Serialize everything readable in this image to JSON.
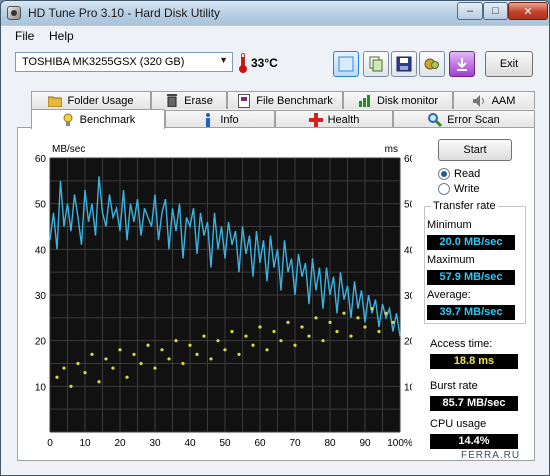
{
  "window": {
    "title": "HD Tune Pro 3.10 - Hard Disk Utility",
    "controls": {
      "minimize": "–",
      "maximize": "□",
      "close": "✕"
    }
  },
  "menu": {
    "file": "File",
    "help": "Help"
  },
  "toolbar": {
    "drive": "TOSHIBA MK3255GSX (320 GB)",
    "temperature": "33°C",
    "exit_label": "Exit",
    "icons": [
      "screenshot-icon",
      "copy-icon",
      "save-icon",
      "options-icon",
      "download-icon"
    ]
  },
  "tabs_top": [
    {
      "label": "Folder Usage",
      "icon": "folder-icon"
    },
    {
      "label": "Erase",
      "icon": "trash-icon"
    },
    {
      "label": "File Benchmark",
      "icon": "file-benchmark-icon"
    },
    {
      "label": "Disk monitor",
      "icon": "disk-monitor-icon"
    },
    {
      "label": "AAM",
      "icon": "speaker-icon"
    }
  ],
  "tabs_bottom": [
    {
      "label": "Benchmark",
      "icon": "benchmark-icon",
      "selected": true
    },
    {
      "label": "Info",
      "icon": "info-icon"
    },
    {
      "label": "Health",
      "icon": "health-icon"
    },
    {
      "label": "Error Scan",
      "icon": "magnifier-icon"
    }
  ],
  "controls": {
    "start_label": "Start",
    "read_label": "Read",
    "write_label": "Write",
    "mode": "Read"
  },
  "stats": {
    "transfer_rate_title": "Transfer rate",
    "minimum_label": "Minimum",
    "minimum_value": "20.0 MB/sec",
    "maximum_label": "Maximum",
    "maximum_value": "57.9 MB/sec",
    "average_label": "Average:",
    "average_value": "39.7 MB/sec",
    "access_label": "Access time:",
    "access_value": "18.8 ms",
    "burst_label": "Burst rate",
    "burst_value": "85.7 MB/sec",
    "cpu_label": "CPU usage",
    "cpu_value": "14.4%"
  },
  "watermark": "FERRA.RU",
  "colors": {
    "chart_bg": "#111111",
    "grid": "#3a3a3a",
    "transfer_line": "#3ab3e0",
    "access_dots": "#d8d848",
    "value_cyan": "#2ec8f0",
    "value_yellow": "#f2e73a"
  },
  "chart_data": {
    "type": "line",
    "ylabel_left": "MB/sec",
    "ylabel_right": "ms",
    "xlim": [
      0,
      100
    ],
    "ylim": [
      0,
      60
    ],
    "x_ticks": [
      "0",
      "10",
      "20",
      "30",
      "40",
      "50",
      "60",
      "70",
      "80",
      "90",
      "100%"
    ],
    "y_ticks": [
      "10",
      "20",
      "30",
      "40",
      "50",
      "60"
    ],
    "y_ticks_right": [
      "10",
      "20",
      "30",
      "40",
      "50",
      "60"
    ],
    "grid": true,
    "series": [
      {
        "values": [
          [
            0,
            42
          ],
          [
            1,
            48
          ],
          [
            2,
            40
          ],
          [
            3,
            55
          ],
          [
            4,
            45
          ],
          [
            5,
            50
          ],
          [
            6,
            44
          ],
          [
            7,
            52
          ],
          [
            8,
            47
          ],
          [
            9,
            41
          ],
          [
            10,
            53
          ],
          [
            11,
            46
          ],
          [
            12,
            50
          ],
          [
            13,
            43
          ],
          [
            14,
            56
          ],
          [
            15,
            48
          ],
          [
            16,
            45
          ],
          [
            17,
            52
          ],
          [
            18,
            47
          ],
          [
            19,
            49
          ],
          [
            20,
            44
          ],
          [
            21,
            53
          ],
          [
            22,
            42
          ],
          [
            23,
            50
          ],
          [
            24,
            46
          ],
          [
            25,
            51
          ],
          [
            26,
            43
          ],
          [
            27,
            49
          ],
          [
            28,
            47
          ],
          [
            29,
            45
          ],
          [
            30,
            52
          ],
          [
            31,
            42
          ],
          [
            32,
            48
          ],
          [
            33,
            51
          ],
          [
            34,
            40
          ],
          [
            35,
            49
          ],
          [
            36,
            44
          ],
          [
            37,
            50
          ],
          [
            38,
            38
          ],
          [
            39,
            47
          ],
          [
            40,
            45
          ],
          [
            41,
            49
          ],
          [
            42,
            39
          ],
          [
            43,
            48
          ],
          [
            44,
            43
          ],
          [
            45,
            46
          ],
          [
            46,
            36
          ],
          [
            47,
            48
          ],
          [
            48,
            40
          ],
          [
            49,
            45
          ],
          [
            50,
            38
          ],
          [
            51,
            46
          ],
          [
            52,
            41
          ],
          [
            53,
            44
          ],
          [
            54,
            35
          ],
          [
            55,
            45
          ],
          [
            56,
            39
          ],
          [
            57,
            43
          ],
          [
            58,
            34
          ],
          [
            59,
            44
          ],
          [
            60,
            37
          ],
          [
            61,
            42
          ],
          [
            62,
            33
          ],
          [
            63,
            43
          ],
          [
            64,
            36
          ],
          [
            65,
            40
          ],
          [
            66,
            31
          ],
          [
            67,
            42
          ],
          [
            68,
            35
          ],
          [
            69,
            38
          ],
          [
            70,
            30
          ],
          [
            71,
            39
          ],
          [
            72,
            34
          ],
          [
            73,
            37
          ],
          [
            74,
            28
          ],
          [
            75,
            38
          ],
          [
            76,
            31
          ],
          [
            77,
            36
          ],
          [
            78,
            27
          ],
          [
            79,
            36
          ],
          [
            80,
            30
          ],
          [
            81,
            34
          ],
          [
            82,
            26
          ],
          [
            83,
            35
          ],
          [
            84,
            29
          ],
          [
            85,
            32
          ],
          [
            86,
            25
          ],
          [
            87,
            33
          ],
          [
            88,
            27
          ],
          [
            89,
            31
          ],
          [
            90,
            24
          ],
          [
            91,
            30
          ],
          [
            92,
            26
          ],
          [
            93,
            29
          ],
          [
            94,
            23
          ],
          [
            95,
            28
          ],
          [
            96,
            25
          ],
          [
            97,
            27
          ],
          [
            98,
            22
          ],
          [
            99,
            26
          ],
          [
            100,
            21
          ]
        ]
      },
      {
        "values": [
          [
            2,
            12
          ],
          [
            4,
            14
          ],
          [
            6,
            10
          ],
          [
            8,
            15
          ],
          [
            10,
            13
          ],
          [
            12,
            17
          ],
          [
            14,
            11
          ],
          [
            16,
            16
          ],
          [
            18,
            14
          ],
          [
            20,
            18
          ],
          [
            22,
            12
          ],
          [
            24,
            17
          ],
          [
            26,
            15
          ],
          [
            28,
            19
          ],
          [
            30,
            14
          ],
          [
            32,
            18
          ],
          [
            34,
            16
          ],
          [
            36,
            20
          ],
          [
            38,
            15
          ],
          [
            40,
            19
          ],
          [
            42,
            17
          ],
          [
            44,
            21
          ],
          [
            46,
            16
          ],
          [
            48,
            20
          ],
          [
            50,
            18
          ],
          [
            52,
            22
          ],
          [
            54,
            17
          ],
          [
            56,
            21
          ],
          [
            58,
            19
          ],
          [
            60,
            23
          ],
          [
            62,
            18
          ],
          [
            64,
            22
          ],
          [
            66,
            20
          ],
          [
            68,
            24
          ],
          [
            70,
            19
          ],
          [
            72,
            23
          ],
          [
            74,
            21
          ],
          [
            76,
            25
          ],
          [
            78,
            20
          ],
          [
            80,
            24
          ],
          [
            82,
            22
          ],
          [
            84,
            26
          ],
          [
            86,
            21
          ],
          [
            88,
            25
          ],
          [
            90,
            23
          ],
          [
            92,
            27
          ],
          [
            94,
            22
          ],
          [
            96,
            26
          ],
          [
            98,
            24
          ]
        ]
      }
    ]
  }
}
